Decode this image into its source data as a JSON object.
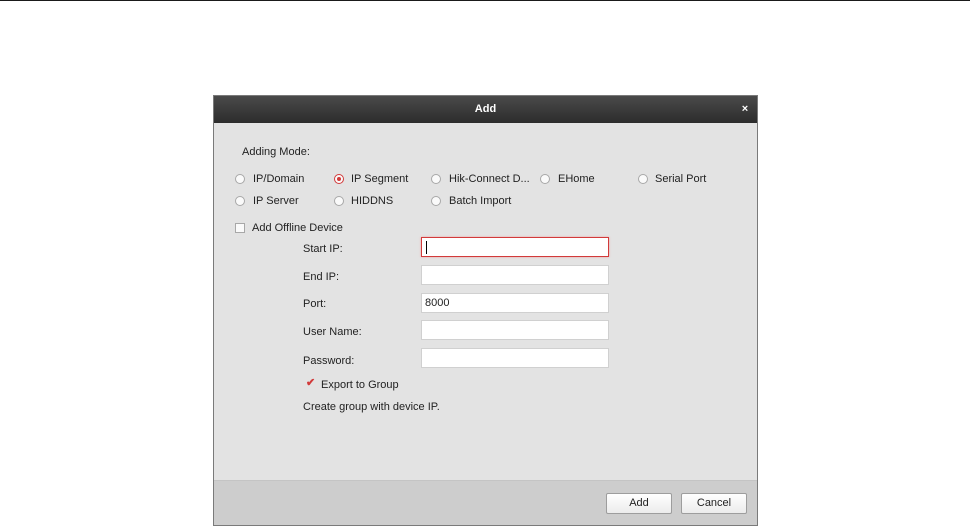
{
  "dialog": {
    "title": "Add",
    "close_glyph": "×",
    "adding_mode_label": "Adding Mode:",
    "modes": [
      {
        "label": "IP/Domain",
        "selected": false
      },
      {
        "label": "IP Segment",
        "selected": true
      },
      {
        "label": "Hik-Connect D...",
        "selected": false
      },
      {
        "label": "EHome",
        "selected": false
      },
      {
        "label": "Serial Port",
        "selected": false
      },
      {
        "label": "IP Server",
        "selected": false
      },
      {
        "label": "HIDDNS",
        "selected": false
      },
      {
        "label": "Batch Import",
        "selected": false
      }
    ],
    "offline_device": {
      "label": "Add Offline Device",
      "checked": false
    },
    "fields": {
      "start_ip": {
        "label": "Start IP:",
        "value": ""
      },
      "end_ip": {
        "label": "End IP:",
        "value": ""
      },
      "port": {
        "label": "Port:",
        "value": "8000"
      },
      "user_name": {
        "label": "User Name:",
        "value": ""
      },
      "password": {
        "label": "Password:",
        "value": ""
      }
    },
    "export_to_group": {
      "label": "Export to Group",
      "checked": true
    },
    "group_hint": "Create group with device IP.",
    "buttons": {
      "add": "Add",
      "cancel": "Cancel"
    }
  },
  "colors": {
    "accent": "#d23a3a",
    "titlebar": "#333333",
    "panel": "#e3e3e3",
    "footer": "#cdcdcd"
  },
  "icons": {
    "close": "close-icon",
    "checkmark": "checkmark-icon"
  }
}
